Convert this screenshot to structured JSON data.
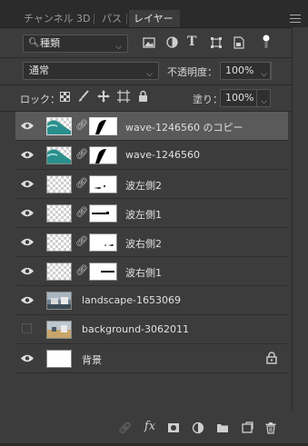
{
  "tabs": [
    "チャンネル",
    "3D",
    "パス",
    "レイヤー"
  ],
  "filter": {
    "label": "種類"
  },
  "blend": {
    "mode": "通常",
    "opacity_label": "不透明度：",
    "opacity_value": "100%"
  },
  "lock": {
    "label": "ロック：",
    "fill_label": "塗り：",
    "fill_value": "100%"
  },
  "layers": [
    {
      "name": "wave-1246560 のコピー",
      "visible": true,
      "selected": true,
      "thumb": "wave",
      "mask": "wave-mask"
    },
    {
      "name": "wave-1246560",
      "visible": true,
      "selected": false,
      "thumb": "wave",
      "mask": "wave-mask"
    },
    {
      "name": "波左側2",
      "visible": true,
      "selected": false,
      "thumb": "transparent",
      "mask": "speck"
    },
    {
      "name": "波左側1",
      "visible": true,
      "selected": false,
      "thumb": "transparent",
      "mask": "bar-left"
    },
    {
      "name": "波右側2",
      "visible": true,
      "selected": false,
      "thumb": "transparent",
      "mask": "speck-right"
    },
    {
      "name": "波右側1",
      "visible": true,
      "selected": false,
      "thumb": "transparent",
      "mask": "bar-right"
    },
    {
      "name": "landscape-1653069",
      "visible": true,
      "selected": false,
      "thumb": "landscape",
      "mask": ""
    },
    {
      "name": "background-3062011",
      "visible": false,
      "selected": false,
      "thumb": "landscape2",
      "mask": ""
    },
    {
      "name": "背景",
      "visible": true,
      "selected": false,
      "thumb": "white",
      "mask": "",
      "locked": true
    }
  ],
  "colors": {
    "panel": "#3c3c3c",
    "selected": "#5a5a5a",
    "tabbar": "#2b2b2b"
  }
}
